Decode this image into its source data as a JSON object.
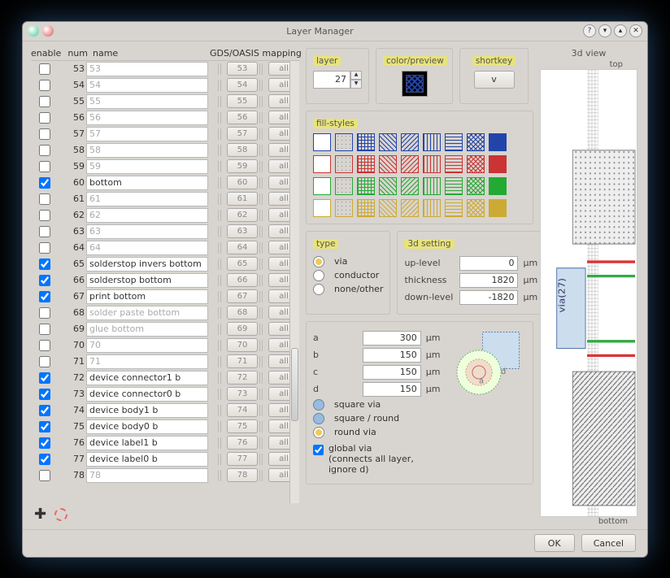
{
  "title": "Layer Manager",
  "headers": {
    "enable": "enable",
    "num": "num",
    "name": "name",
    "map": "GDS/OASIS mapping"
  },
  "rows": [
    {
      "en": false,
      "num": 53,
      "name": "53",
      "grey": true
    },
    {
      "en": false,
      "num": 54,
      "name": "54",
      "grey": true
    },
    {
      "en": false,
      "num": 55,
      "name": "55",
      "grey": true
    },
    {
      "en": false,
      "num": 56,
      "name": "56",
      "grey": true
    },
    {
      "en": false,
      "num": 57,
      "name": "57",
      "grey": true
    },
    {
      "en": false,
      "num": 58,
      "name": "58",
      "grey": true
    },
    {
      "en": false,
      "num": 59,
      "name": "59",
      "grey": true
    },
    {
      "en": true,
      "num": 60,
      "name": "bottom",
      "grey": false
    },
    {
      "en": false,
      "num": 61,
      "name": "61",
      "grey": true
    },
    {
      "en": false,
      "num": 62,
      "name": "62",
      "grey": true
    },
    {
      "en": false,
      "num": 63,
      "name": "63",
      "grey": true
    },
    {
      "en": false,
      "num": 64,
      "name": "64",
      "grey": true
    },
    {
      "en": true,
      "num": 65,
      "name": "solderstop invers bottom",
      "grey": false
    },
    {
      "en": true,
      "num": 66,
      "name": "solderstop bottom",
      "grey": false
    },
    {
      "en": true,
      "num": 67,
      "name": "print bottom",
      "grey": false
    },
    {
      "en": false,
      "num": 68,
      "name": "solder paste bottom",
      "grey": true
    },
    {
      "en": false,
      "num": 69,
      "name": "glue bottom",
      "grey": true
    },
    {
      "en": false,
      "num": 70,
      "name": "70",
      "grey": true
    },
    {
      "en": false,
      "num": 71,
      "name": "71",
      "grey": true
    },
    {
      "en": true,
      "num": 72,
      "name": "device connector1 b",
      "grey": false
    },
    {
      "en": true,
      "num": 73,
      "name": "device connector0 b",
      "grey": false
    },
    {
      "en": true,
      "num": 74,
      "name": "device body1 b",
      "grey": false
    },
    {
      "en": true,
      "num": 75,
      "name": "device body0 b",
      "grey": false
    },
    {
      "en": true,
      "num": 76,
      "name": "device label1 b",
      "grey": false
    },
    {
      "en": true,
      "num": 77,
      "name": "device label0 b",
      "grey": false
    },
    {
      "en": false,
      "num": 78,
      "name": "78",
      "grey": true
    }
  ],
  "all_label": "all",
  "panel": {
    "layer": "layer",
    "layer_val": "27",
    "color": "color/preview",
    "shortkey": "shortkey",
    "shortkey_val": "v",
    "fill": "fill-styles",
    "type": "type",
    "via": "via",
    "conductor": "conductor",
    "none": "none/other",
    "threed": "3d setting",
    "up": "up-level",
    "up_v": "0",
    "th": "thickness",
    "th_v": "1820",
    "dn": "down-level",
    "dn_v": "-1820",
    "um": "μm",
    "a": "a",
    "a_v": "300",
    "b": "b",
    "b_v": "150",
    "c": "c",
    "c_v": "150",
    "d": "d",
    "d_v": "150",
    "sq": "square via",
    "sqr": "square / round",
    "rnd": "round via",
    "glob": "global via\n(connects all layer,\nignore d)",
    "view3d": "3d view",
    "top": "top",
    "bottom": "bottom",
    "via27": "via(27)"
  },
  "buttons": {
    "ok": "OK",
    "cancel": "Cancel"
  }
}
